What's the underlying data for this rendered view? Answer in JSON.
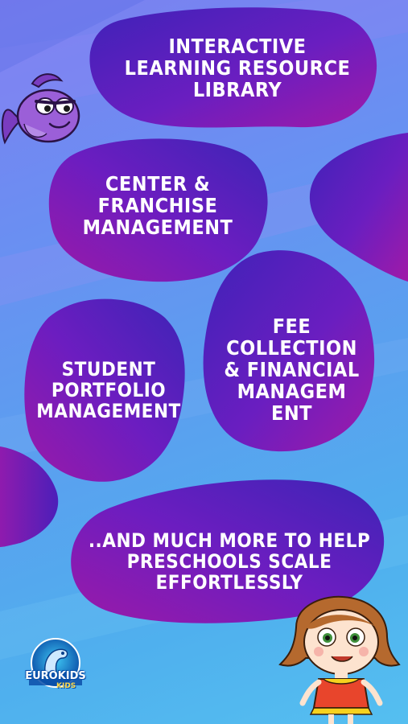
{
  "features": [
    "INTERACTIVE LEARNING RESOURCE LIBRARY",
    "CENTER & FRANCHISE MANAGEMENT",
    "STUDENT PORTFOLIO MANAGEMENT",
    "FEE COLLECTION & FINANCIAL MANAGEM ENT",
    "..AND MUCH MORE TO HELP PRESCHOOLS SCALE EFFORTLESSLY"
  ],
  "logo": {
    "name": "EUROKIDS",
    "sub": "KIDS"
  },
  "colors": {
    "blob_dark": "#4a1db8",
    "blob_mid": "#7a1ec0",
    "blob_light": "#a21cab",
    "background_top": "#7d7ff0",
    "background_bottom": "#55bff0"
  },
  "icons": [
    "fish-mascot-icon",
    "girl-mascot-icon",
    "brand-logo-icon"
  ]
}
